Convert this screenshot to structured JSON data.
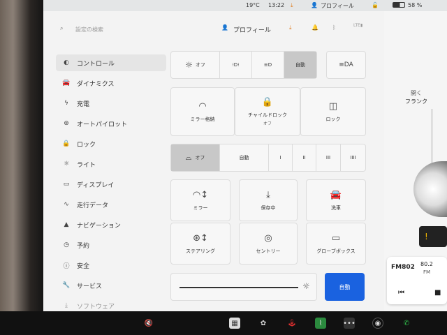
{
  "status": {
    "temp": "19°C",
    "time": "13:22",
    "profile": "プロフィール",
    "battery": "58 %"
  },
  "top": {
    "search_placeholder": "設定の検索",
    "profile": "プロフィール"
  },
  "sidebar": {
    "items": [
      {
        "label": "コントロール",
        "icon": "toggle-icon"
      },
      {
        "label": "ダイナミクス",
        "icon": "car-icon"
      },
      {
        "label": "充電",
        "icon": "bolt-icon"
      },
      {
        "label": "オートパイロット",
        "icon": "steering-icon"
      },
      {
        "label": "ロック",
        "icon": "lock-icon"
      },
      {
        "label": "ライト",
        "icon": "sun-icon"
      },
      {
        "label": "ディスプレイ",
        "icon": "display-icon"
      },
      {
        "label": "走行データ",
        "icon": "trip-icon"
      },
      {
        "label": "ナビゲーション",
        "icon": "navigation-icon"
      },
      {
        "label": "予約",
        "icon": "clock-icon"
      },
      {
        "label": "安全",
        "icon": "info-icon"
      },
      {
        "label": "サービス",
        "icon": "wrench-icon"
      },
      {
        "label": "ソフトウェア",
        "icon": "download-icon"
      }
    ]
  },
  "lights": {
    "off": "オフ",
    "auto": "自動"
  },
  "row2": {
    "mirror": "ミラー格納",
    "child_lock": "チャイルドロック",
    "child_lock_state": "オフ",
    "lock": "ロック"
  },
  "wipers": {
    "off": "オフ",
    "auto": "自動",
    "speeds": [
      "I",
      "II",
      "III",
      "IIII"
    ]
  },
  "grid": {
    "mirror": "ミラー",
    "download": "保存中",
    "carwash": "洗車",
    "steering": "ステアリング",
    "sentry": "セントリー",
    "glovebox": "グローブボックス"
  },
  "brightness": {
    "auto": "自動"
  },
  "right": {
    "frunk_line1": "開く",
    "frunk_line2": "フランク",
    "alert": "!"
  },
  "radio": {
    "logo": "FM802",
    "freq": "80.2",
    "band": "FM"
  },
  "colors": {
    "accent": "#1a62e0",
    "orange": "#e07a1a"
  }
}
